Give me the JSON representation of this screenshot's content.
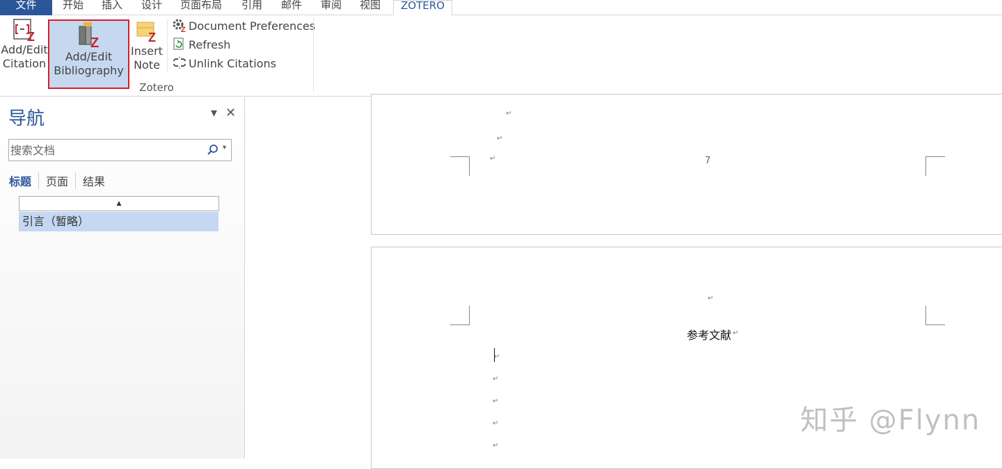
{
  "tabs": {
    "file": "文件",
    "home": "开始",
    "insert": "插入",
    "design": "设计",
    "layout": "页面布局",
    "references": "引用",
    "mailings": "邮件",
    "review": "审阅",
    "view": "视图",
    "zotero": "ZOTERO"
  },
  "ribbon": {
    "add_citation_line1": "Add/Edit",
    "add_citation_line2": "Citation",
    "add_bib_line1": "Add/Edit",
    "add_bib_line2": "Bibliography",
    "insert_note_line1": "Insert",
    "insert_note_line2": "Note",
    "doc_prefs": "Document Preferences",
    "refresh": "Refresh",
    "unlink": "Unlink Citations",
    "group_label": "Zotero"
  },
  "nav": {
    "title": "导航",
    "search_placeholder": "搜索文档",
    "tabs": [
      "标题",
      "页面",
      "结果"
    ],
    "collapse_glyph": "▲",
    "heading_item": "引言（暂略）"
  },
  "document": {
    "page_number": "7",
    "para_mark": "↵",
    "ref_title": "参考文献"
  },
  "watermark": "知乎 @Flynn",
  "colors": {
    "accent": "#2b579a",
    "highlight_border": "#d61f26",
    "selection": "#c5d8f2"
  }
}
